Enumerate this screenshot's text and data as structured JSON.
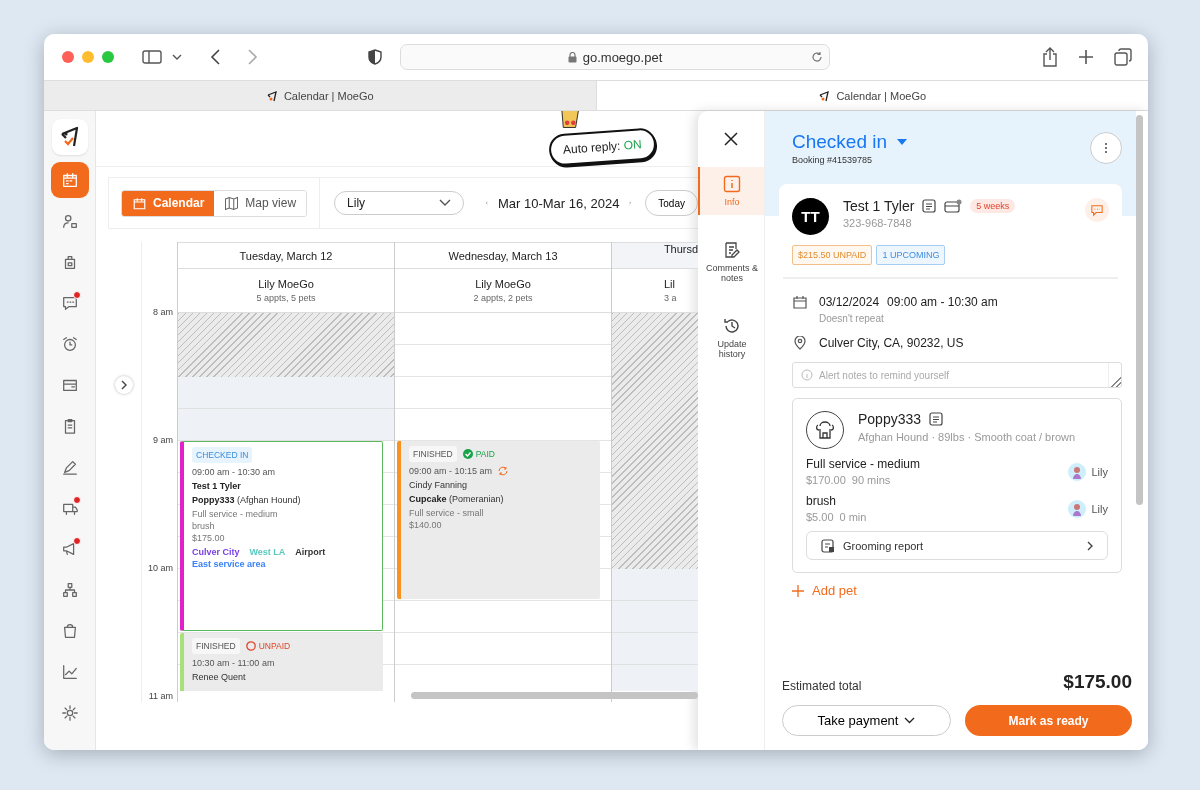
{
  "browser": {
    "url": "go.moego.pet",
    "tabs": [
      {
        "title": "Calendar | MoeGo",
        "selected": false
      },
      {
        "title": "Calendar | MoeGo",
        "selected": true
      }
    ]
  },
  "sidebar": {
    "items": [
      {
        "selected": true,
        "badge": false
      },
      {
        "selected": false,
        "badge": false
      },
      {
        "selected": false,
        "badge": false
      },
      {
        "selected": false,
        "badge": true
      },
      {
        "selected": false,
        "badge": false
      },
      {
        "selected": false,
        "badge": false
      },
      {
        "selected": false,
        "badge": false
      },
      {
        "selected": false,
        "badge": false
      },
      {
        "selected": false,
        "badge": true
      },
      {
        "selected": false,
        "badge": true
      },
      {
        "selected": false,
        "badge": false
      },
      {
        "selected": false,
        "badge": false
      },
      {
        "selected": false,
        "badge": false
      },
      {
        "selected": false,
        "badge": false
      }
    ]
  },
  "header": {
    "auto_reply_label": "Auto reply:",
    "auto_reply_state": "ON"
  },
  "toolbar": {
    "views": [
      {
        "label": "Calendar",
        "selected": true
      },
      {
        "label": "Map view",
        "selected": false
      }
    ],
    "staff": "Lily",
    "date_range": "Mar 10-Mar 16, 2024",
    "today": "Today"
  },
  "calendar": {
    "hours": [
      "8 am",
      "9 am",
      "10 am",
      "11 am"
    ],
    "days": [
      {
        "title": "Tuesday, March 12",
        "staff": "Lily MoeGo",
        "summary": "5 appts, 5 pets",
        "kind": "late-start",
        "appointments": [
          {
            "selected": true,
            "color": "#e020c8",
            "status": {
              "label": "CHECKED IN",
              "kind": "checked-in"
            },
            "time": "09:00 am - 10:30 am",
            "recurring": false,
            "client": "Test 1 Tyler",
            "pet": "Poppy333",
            "breed": "(Afghan Hound)",
            "services": [
              "Full service - medium",
              "brush"
            ],
            "price": "$175.00",
            "areas": [
              {
                "name": "Culver City",
                "color": "#7b3fe4"
              },
              {
                "name": "West LA",
                "color": "#5cc8c0"
              },
              {
                "name": "Airport",
                "color": "#333333"
              },
              {
                "name": "East service area",
                "color": "#3b82f6"
              }
            ]
          },
          {
            "selected": false,
            "color": "#a8e07a",
            "status": {
              "label": "FINISHED",
              "kind": "finished"
            },
            "payment": {
              "label": "UNPAID",
              "kind": "unpaid"
            },
            "time": "10:30 am - 11:00 am",
            "recurring": false,
            "client": "Renee Quent"
          }
        ]
      },
      {
        "title": "Wednesday, March 13",
        "staff": "Lily MoeGo",
        "summary": "2 appts, 2 pets",
        "kind": "open",
        "appointments": [
          {
            "selected": false,
            "color": "#f7931e",
            "status": {
              "label": "FINISHED",
              "kind": "finished"
            },
            "payment": {
              "label": "PAID",
              "kind": "paid"
            },
            "time": "09:00 am - 10:15 am",
            "recurring": true,
            "client": "Cindy Fanning",
            "pet": "Cupcake",
            "breed": "(Pomeranian)",
            "services": [
              "Full service - small"
            ],
            "price": "$140.00"
          }
        ]
      },
      {
        "title": "Thursd",
        "staff": "Lil",
        "summary": "3 a",
        "kind": "closed-morning"
      }
    ]
  },
  "panel": {
    "tabs": [
      {
        "label": "Info",
        "selected": true
      },
      {
        "label": "Comments & notes",
        "selected": false
      },
      {
        "label": "Update history",
        "selected": false
      }
    ],
    "status": "Checked in",
    "booking": "Booking #41539785",
    "client": {
      "initials": "TT",
      "name": "Test 1 Tyler",
      "tag": "5 weeks",
      "phone": "323-968-7848",
      "badges": [
        {
          "label": "$215.50 UNPAID",
          "kind": "unpaid"
        },
        {
          "label": "1 UPCOMING",
          "kind": "upcoming"
        }
      ]
    },
    "schedule": {
      "date": "03/12/2024",
      "time": "09:00 am - 10:30 am",
      "repeat": "Doesn't repeat",
      "address": "Culver City, CA, 90232, US"
    },
    "alert_notes": {
      "placeholder": "Alert notes to remind yourself"
    },
    "pet": {
      "name": "Poppy333",
      "details": "Afghan Hound · 89lbs · Smooth coat / brown",
      "services": [
        {
          "name": "Full service - medium",
          "price": "$170.00",
          "duration": "90 mins",
          "staff": "Lily"
        },
        {
          "name": "brush",
          "price": "$5.00",
          "duration": "0 min",
          "staff": "Lily"
        }
      ],
      "report": "Grooming report"
    },
    "add_pet": "Add pet",
    "total_label": "Estimated total",
    "total": "$175.00",
    "actions": {
      "secondary": "Take payment",
      "primary": "Mark as ready"
    }
  }
}
